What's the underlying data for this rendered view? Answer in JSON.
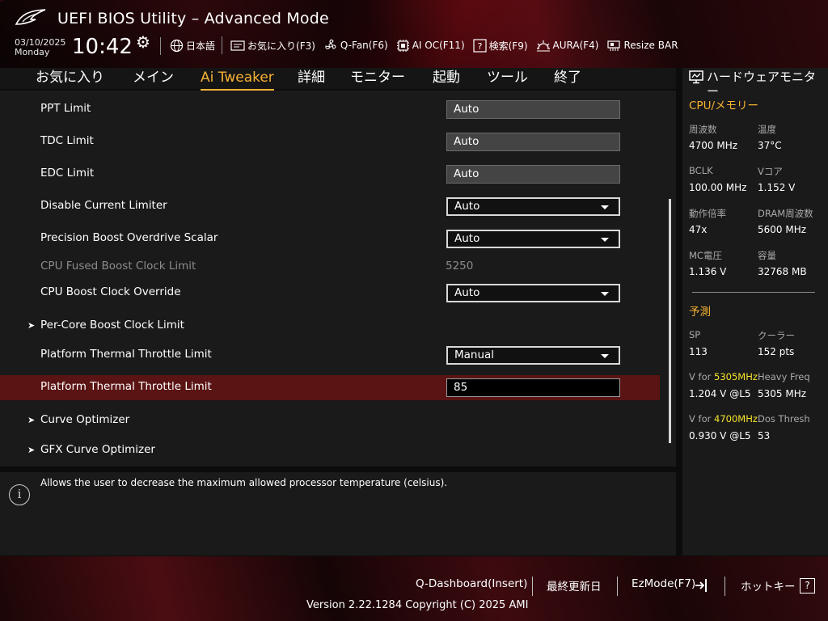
{
  "header": {
    "title": "UEFI BIOS Utility – Advanced Mode",
    "date": "03/10/2025",
    "day": "Monday",
    "time": "10:42",
    "toolbar": [
      {
        "name": "language",
        "icon": "globe-icon",
        "label": "日本語"
      },
      {
        "name": "favorites",
        "icon": "favorites-icon",
        "label": "お気に入り(F3)"
      },
      {
        "name": "qfan",
        "icon": "fan-icon",
        "label": "Q-Fan(F6)"
      },
      {
        "name": "aioc",
        "icon": "ai-oc-icon",
        "label": "AI OC(F11)"
      },
      {
        "name": "search",
        "icon": "search-help-icon",
        "label": "検索(F9)"
      },
      {
        "name": "aura",
        "icon": "aura-icon",
        "label": "AURA(F4)"
      },
      {
        "name": "resizebar",
        "icon": "resize-bar-icon",
        "label": "Resize BAR"
      }
    ]
  },
  "tabs": [
    {
      "label": "お気に入り",
      "active": false
    },
    {
      "label": "メイン",
      "active": false
    },
    {
      "label": "Ai Tweaker",
      "active": true
    },
    {
      "label": "詳細",
      "active": false
    },
    {
      "label": "モニター",
      "active": false
    },
    {
      "label": "起動",
      "active": false
    },
    {
      "label": "ツール",
      "active": false
    },
    {
      "label": "終了",
      "active": false
    }
  ],
  "settings": [
    {
      "label": "PPT Limit",
      "type": "readonly",
      "value": "Auto"
    },
    {
      "label": "TDC Limit",
      "type": "readonly",
      "value": "Auto"
    },
    {
      "label": "EDC Limit",
      "type": "readonly",
      "value": "Auto"
    },
    {
      "label": "Disable Current Limiter",
      "type": "dropdown",
      "value": "Auto"
    },
    {
      "label": "Precision Boost Overdrive Scalar",
      "type": "dropdown",
      "value": "Auto"
    },
    {
      "label": "CPU Fused Boost Clock Limit",
      "type": "static",
      "value": "5250"
    },
    {
      "label": "CPU Boost Clock Override",
      "type": "dropdown",
      "value": "Auto"
    },
    {
      "label": "Per-Core Boost Clock Limit",
      "type": "submenu"
    },
    {
      "label": "Platform Thermal Throttle Limit",
      "type": "dropdown",
      "value": "Manual"
    },
    {
      "label": "Platform Thermal Throttle Limit",
      "type": "input",
      "value": "85",
      "selected": true
    },
    {
      "label": "Curve Optimizer",
      "type": "submenu"
    },
    {
      "label": "GFX Curve Optimizer",
      "type": "submenu"
    }
  ],
  "help_text": "Allows the user to decrease the maximum allowed processor temperature (celsius).",
  "hw_monitor": {
    "title": "ハードウェアモニター",
    "cpu_section": "CPU/メモリー",
    "cpu_items": [
      {
        "label": "周波数",
        "value": "4700 MHz"
      },
      {
        "label": "温度",
        "value": "37°C"
      },
      {
        "label": "BCLK",
        "value": "100.00 MHz"
      },
      {
        "label": "Vコア",
        "value": "1.152 V"
      },
      {
        "label": "動作倍率",
        "value": "47x"
      },
      {
        "label": "DRAM周波数",
        "value": "5600 MHz"
      },
      {
        "label": "MC電圧",
        "value": "1.136 V"
      },
      {
        "label": "容量",
        "value": "32768 MB"
      }
    ],
    "predict_section": "予測",
    "predict_items": [
      {
        "label": "SP",
        "value": "113"
      },
      {
        "label": "クーラー",
        "value": "152 pts"
      },
      {
        "label_prefix": "V for ",
        "label_freq": "5305MHz",
        "value": "1.204 V @L5"
      },
      {
        "label": "Heavy Freq",
        "value": "5305 MHz"
      },
      {
        "label_prefix": "V for ",
        "label_freq": "4700MHz",
        "value": "0.930 V @L5"
      },
      {
        "label": "Dos Thresh",
        "value": "53"
      }
    ]
  },
  "footer": {
    "qdashboard": "Q-Dashboard(Insert)",
    "last_modified": "最終更新日",
    "ezmode": "EzMode(F7)",
    "hotkeys": "ホットキー",
    "hotkey_symbol": "?",
    "version": "Version 2.22.1284 Copyright (C) 2025 AMI"
  },
  "colors": {
    "accent": "#f6b133",
    "selected_row": "#5b1414",
    "frequency_highlight": "#f6e52b"
  }
}
